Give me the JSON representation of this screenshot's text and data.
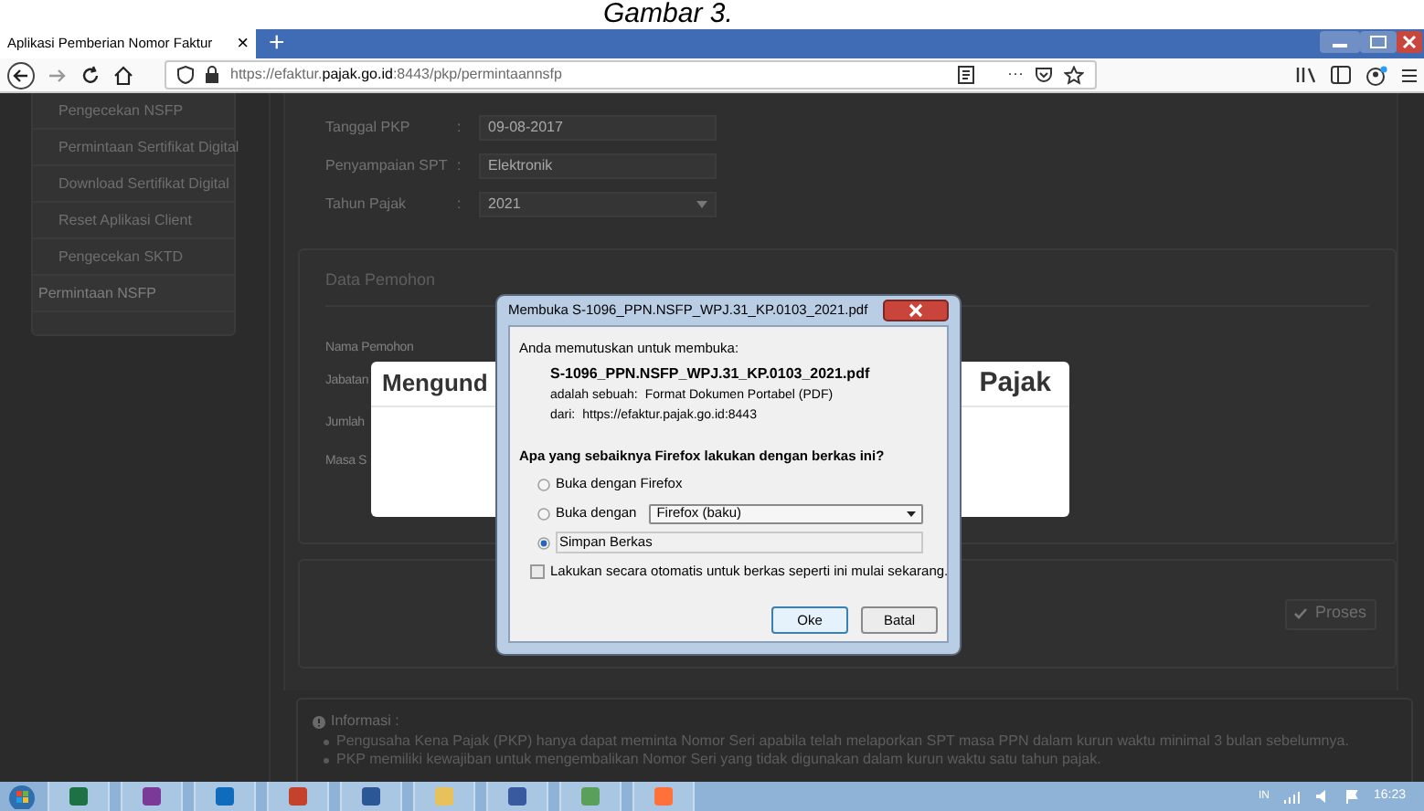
{
  "caption": "Gambar 3.",
  "browser": {
    "tab": {
      "title": "Aplikasi Pemberian Nomor Faktur",
      "close": "×",
      "selected": true
    },
    "new_tab": "+",
    "url": "https://efaktur.**pajak.go.id**:8443/pkp/permintaannsfp",
    "page_actions": "···"
  },
  "sidebar": {
    "items": [
      {
        "label": "Pengecekan NSFP",
        "selected": false
      },
      {
        "label": "Permintaan Sertifikat Digital",
        "selected": false
      },
      {
        "label": "Download Sertifikat Digital",
        "selected": false
      },
      {
        "label": "Reset Aplikasi Client",
        "selected": false
      },
      {
        "label": "Pengecekan SKTD",
        "selected": false
      },
      {
        "label": "Permintaan NSFP",
        "selected": true
      }
    ]
  },
  "form_fields": [
    {
      "label": "Tanggal PKP",
      "separator": ":",
      "value": "09-08-2017",
      "kind": "text"
    },
    {
      "label": "Penyampaian SPT",
      "separator": ":",
      "value": "Elektronik",
      "kind": "text"
    },
    {
      "label": "Tahun Pajak",
      "separator": ":",
      "value": "2021",
      "kind": "select"
    }
  ],
  "applicant_section": {
    "title": "Data Pemohon",
    "labels": [
      "Nama Pemohon",
      "Jabatan",
      "Jumlah",
      "Masa S"
    ]
  },
  "progress_modal": {
    "title_start": "Mengund",
    "title_end": "Pajak"
  },
  "submit_button": "Proses",
  "info": {
    "title": "Informasi :",
    "items": [
      "Pengusaha Kena Pajak (PKP) hanya dapat meminta Nomor Seri apabila telah melaporkan SPT masa PPN dalam kurun waktu minimal 3 bulan sebelumnya.",
      "PKP memiliki kewajiban untuk mengembalikan Nomor Seri yang tidak digunakan dalam kurun waktu satu tahun pajak."
    ]
  },
  "dialog": {
    "title": "Membuka S-1096_PPN.NSFP_WPJ.31_KP.0103_2021.pdf",
    "intro": "Anda memutuskan untuk membuka:",
    "filename": "S-1096_PPN.NSFP_WPJ.31_KP.0103_2021.pdf",
    "details": [
      {
        "label": "adalah sebuah:",
        "value": "Format Dokumen Portabel (PDF)"
      },
      {
        "label": "dari:",
        "value": "https://efaktur.pajak.go.id:8443"
      }
    ],
    "question": "Apa yang sebaiknya Firefox lakukan dengan berkas ini?",
    "options": [
      {
        "label": "Buka dengan Firefox",
        "selected": false
      },
      {
        "label": "Buka dengan",
        "selected": false,
        "app": "Firefox (baku)"
      },
      {
        "label": "Simpan Berkas",
        "selected": true
      }
    ],
    "remember": {
      "label": "Lakukan secara otomatis untuk berkas seperti ini mulai sekarang.",
      "checked": false
    },
    "buttons": [
      "Oke",
      "Batal"
    ]
  },
  "taskbar": {
    "language": "IN",
    "time": "16:23"
  }
}
